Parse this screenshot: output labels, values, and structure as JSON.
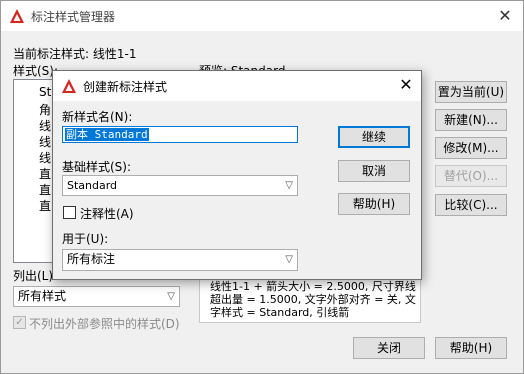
{
  "outer": {
    "title": "标注样式管理器",
    "current_style_label": "当前标注样式: 线性1-1",
    "styles_label": "样式(S):",
    "styles_items": [
      "St",
      "角",
      "线",
      "线",
      "线",
      "直",
      "直",
      "直"
    ],
    "preview_label": "预览: Standard",
    "list_label": "列出(L):",
    "list_value": "所有样式",
    "exclude_xref_label": "不列出外部参照中的样式(D)",
    "description": "线性1-1 + 箭头大小 = 2.5000, 尺寸界线超出量 = 1.5000, 文字外部对齐 = 关, 文字样式 = Standard, 引线箭",
    "buttons": {
      "set_current": "置为当前(U)",
      "new": "新建(N)...",
      "modify": "修改(M)...",
      "override": "替代(O)...",
      "compare": "比较(C)...",
      "close": "关闭",
      "help": "帮助(H)"
    }
  },
  "dialog": {
    "title": "创建新标注样式",
    "new_name_label": "新样式名(N):",
    "new_name_value": "副本 Standard",
    "base_style_label": "基础样式(S):",
    "base_style_value": "Standard",
    "annotative_label": "注释性(A)",
    "use_for_label": "用于(U):",
    "use_for_value": "所有标注",
    "buttons": {
      "continue": "继续",
      "cancel": "取消",
      "help": "帮助(H)"
    }
  },
  "colors": {
    "accent": "#0078d7",
    "app_icon": "#d7261e",
    "window_bg": "#f0f0f0"
  }
}
